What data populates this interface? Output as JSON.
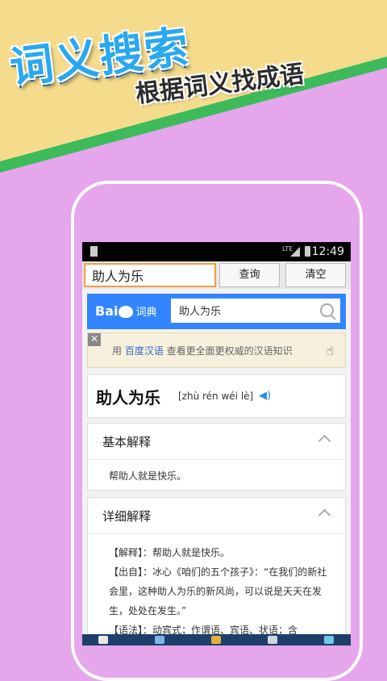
{
  "promo": {
    "title": "词义搜索",
    "subtitle": "根据词义找成语"
  },
  "colors": {
    "background_pink": "#e6a6ec",
    "top_yellow": "#f4dc8c",
    "accent_green": "#3dbb5a",
    "baidu_blue": "#3385ff",
    "input_border_orange": "#f0a040"
  },
  "status_bar": {
    "time": "12:49",
    "network": "LTE",
    "icons": [
      "sd-card-icon",
      "lte-icon",
      "signal-icon",
      "battery-icon"
    ]
  },
  "search_row": {
    "input_value": "助人为乐",
    "query_label": "查询",
    "clear_label": "清空"
  },
  "baidu_bar": {
    "logo_text_left": "Bai",
    "logo_text_right": "词典",
    "search_value": "助人为乐",
    "icon": "search-icon"
  },
  "tip": {
    "close": "✕",
    "prefix": "用 ",
    "link": "百度汉语",
    "suffix": " 查看更全面更权威的汉语知识",
    "icon": "hand-pointer-icon"
  },
  "word_card": {
    "word": "助人为乐",
    "pinyin": "[zhù rén wéi lè]",
    "icon": "speaker-icon"
  },
  "basic_card": {
    "heading": "基本解释",
    "body": "帮助人就是快乐。"
  },
  "detail_card": {
    "heading": "详细解释",
    "line1": "【解释】：帮助人就是快乐。",
    "line2": "【出自】：冰心《咱们的五个孩子》：“在我们的新社会里，这种助人为乐的新风尚，可以说是天天在发生，处处在发生。”",
    "line3": "【语法】：动宾式；作谓语、宾语、状语；含"
  }
}
